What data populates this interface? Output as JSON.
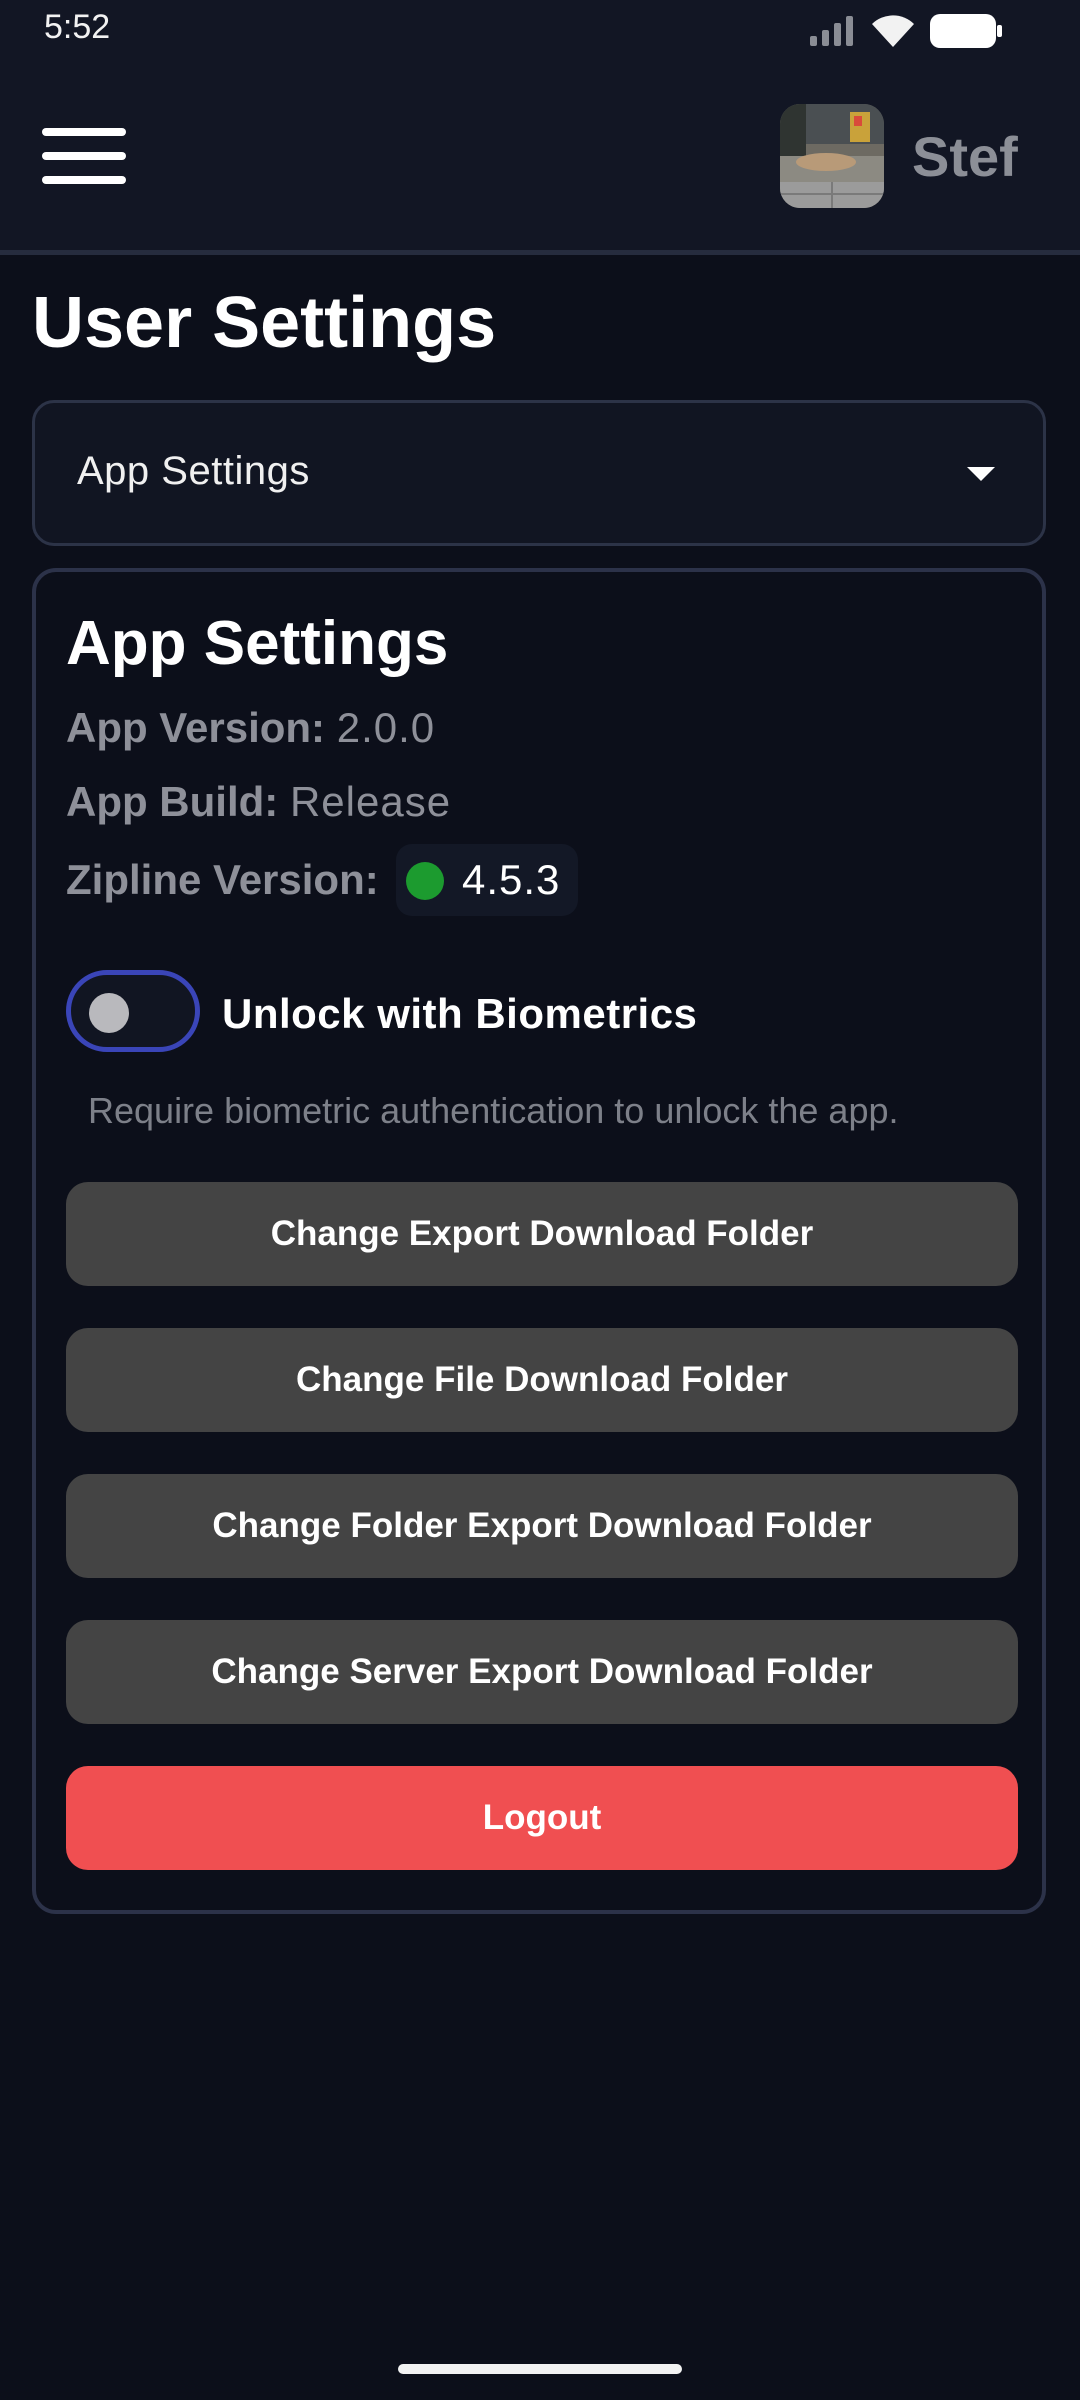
{
  "status_bar": {
    "time": "5:52",
    "icons": [
      "signal-icon",
      "wifi-icon",
      "battery-icon"
    ]
  },
  "header": {
    "menu_icon": "hamburger-menu-icon",
    "username": "Stef"
  },
  "page": {
    "title": "User Settings"
  },
  "section_select": {
    "value": "App Settings"
  },
  "app_settings": {
    "title": "App Settings",
    "app_version_label": "App Version:",
    "app_version_value": "2.0.0",
    "app_build_label": "App Build:",
    "app_build_value": "Release",
    "zipline_version_label": "Zipline Version:",
    "zipline_version_value": "4.5.3",
    "zipline_status_color": "#1c9b2f",
    "biometrics_label": "Unlock with Biometrics",
    "biometrics_enabled": false,
    "biometrics_description": "Require biometric authentication to unlock the app.",
    "buttons": {
      "export_folder": "Change Export Download Folder",
      "file_folder": "Change File Download Folder",
      "folder_export_folder": "Change Folder Export Download Folder",
      "server_export_folder": "Change Server Export Download Folder",
      "logout": "Logout"
    }
  },
  "colors": {
    "background": "#0c0f1a",
    "header": "#121624",
    "toggle_border": "#3a45b8",
    "button": "#444444",
    "danger": "#f04f51"
  }
}
